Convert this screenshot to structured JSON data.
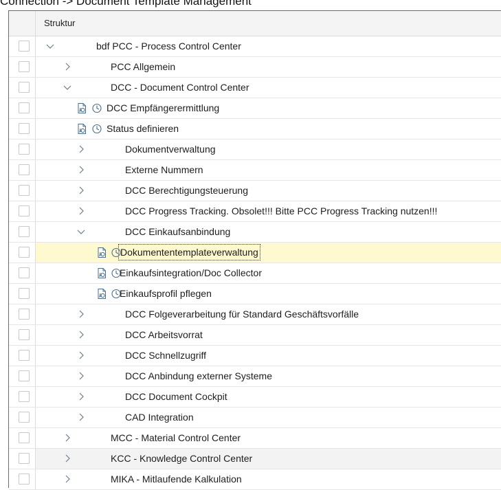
{
  "breadcrumb": "Connection -> Document Template Management",
  "table": {
    "column_header": "Struktur",
    "rows": [
      {
        "label": "bdf PCC - Process Control Center",
        "kind": "folder",
        "level": 0,
        "expanded": true
      },
      {
        "label": "PCC Allgemein",
        "kind": "folder",
        "level": 1,
        "expanded": false
      },
      {
        "label": "DCC - Document Control Center",
        "kind": "folder",
        "level": 1,
        "expanded": true
      },
      {
        "label": "DCC Empfängerermittlung",
        "kind": "activity",
        "level": 2
      },
      {
        "label": "Status definieren",
        "kind": "activity",
        "level": 2
      },
      {
        "label": "Dokumentverwaltung",
        "kind": "folder",
        "level": 2,
        "expanded": false
      },
      {
        "label": "Externe Nummern",
        "kind": "folder",
        "level": 2,
        "expanded": false
      },
      {
        "label": "DCC Berechtigungsteuerung",
        "kind": "folder",
        "level": 2,
        "expanded": false
      },
      {
        "label": "DCC Progress Tracking. Obsolet!!! Bitte PCC Progress Tracking nutzen!!!",
        "kind": "folder",
        "level": 2,
        "expanded": false
      },
      {
        "label": "DCC Einkaufsanbindung",
        "kind": "folder",
        "level": 2,
        "expanded": true
      },
      {
        "label": "Dokumententemplateverwaltung",
        "kind": "activity",
        "level": 3,
        "selected": true
      },
      {
        "label": "Einkaufsintegration/Doc Collector",
        "kind": "activity",
        "level": 3
      },
      {
        "label": "Einkaufsprofil pflegen",
        "kind": "activity",
        "level": 3
      },
      {
        "label": "DCC Folgeverarbeitung für Standard Geschäftsvorfälle",
        "kind": "folder",
        "level": 2,
        "expanded": false
      },
      {
        "label": "DCC Arbeitsvorrat",
        "kind": "folder",
        "level": 2,
        "expanded": false
      },
      {
        "label": "DCC Schnellzugriff",
        "kind": "folder",
        "level": 2,
        "expanded": false
      },
      {
        "label": "DCC Anbindung externer Systeme",
        "kind": "folder",
        "level": 2,
        "expanded": false
      },
      {
        "label": "DCC Document Cockpit",
        "kind": "folder",
        "level": 2,
        "expanded": false
      },
      {
        "label": "CAD Integration",
        "kind": "folder",
        "level": 2,
        "expanded": false
      },
      {
        "label": "MCC - Material Control Center",
        "kind": "folder",
        "level": 1,
        "expanded": false
      },
      {
        "label": "KCC - Knowledge Control Center",
        "kind": "folder",
        "level": 1,
        "expanded": false,
        "shaded": true
      },
      {
        "label": "MIKA - Mitlaufende Kalkulation",
        "kind": "folder",
        "level": 1,
        "expanded": false
      }
    ]
  },
  "icons": {
    "expand": "chevron-right-icon",
    "collapse": "chevron-down-icon",
    "document": "document-icon",
    "clock": "clock-icon"
  },
  "colors": {
    "selected_row": "#fff9cf",
    "shaded_row": "#f3f3f3",
    "icon_stroke": "#4a6b8a"
  }
}
